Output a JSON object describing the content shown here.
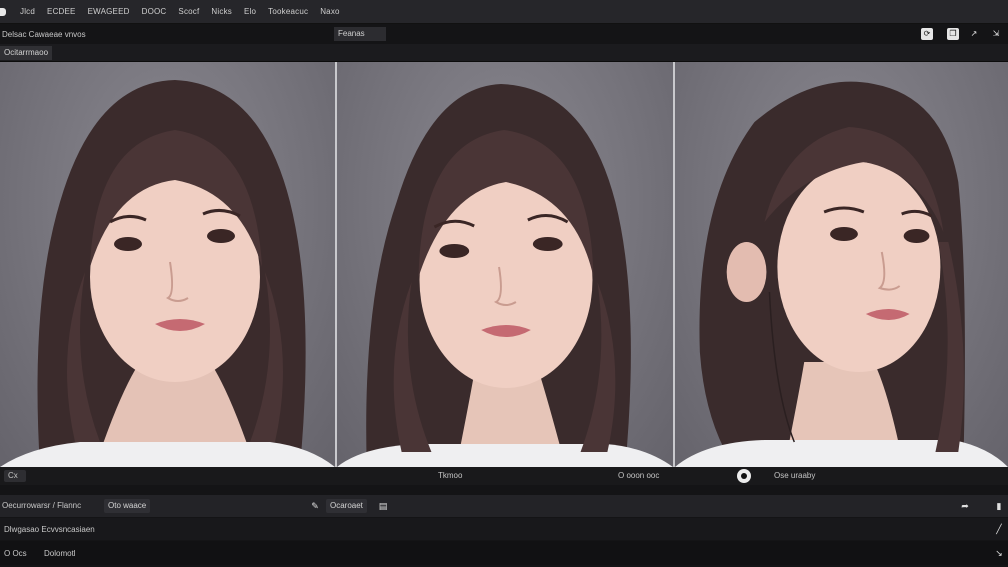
{
  "menubar": {
    "items": [
      "Jlcd",
      "ECDEE",
      "EWAGEED",
      "DOOC",
      "Scocf",
      "Nicks",
      "Elo",
      "Tookeacuc",
      "Naxo"
    ]
  },
  "toolbar": {
    "title": "Delsac Cawaeae vnvos",
    "field_value": "Feanas",
    "icons": [
      "refresh-icon",
      "copy-icon",
      "pointer-icon",
      "expand-icon"
    ]
  },
  "panel": {
    "tab_label": "Ocitarrmaoo"
  },
  "viewer": {
    "frames": [
      "portrait-frame-1",
      "portrait-frame-2",
      "portrait-frame-3"
    ]
  },
  "captionbar": {
    "left_label": "Cx",
    "center_label": "Tkmoo",
    "right_label": "O ooon ooc",
    "status_label": "Ose   uraaby"
  },
  "bottom": {
    "row1_left": "Oecurrowarsr / Flannc",
    "row1_pill": "Oto waace",
    "row1_mid": "Ocaroaet",
    "row2_left": "Dlwgasao Ecvvsncasiaen",
    "row3_left": "O  Ocs",
    "row3_mid": "Dolomotl"
  },
  "colors": {
    "accent": "#e6e6e6",
    "background": "#1c1c1e",
    "viewer_bg": "#7a7880"
  }
}
